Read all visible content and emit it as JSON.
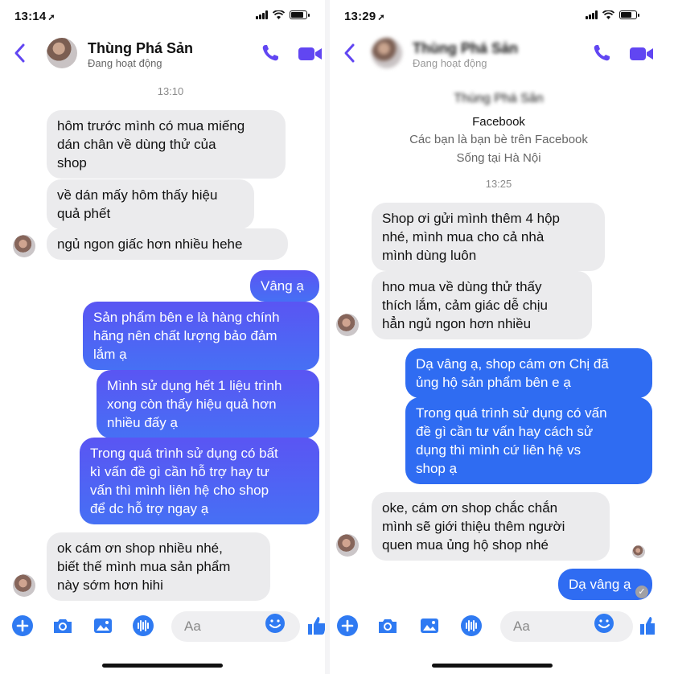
{
  "colors": {
    "accent": "#6146f2",
    "outgoing": "#4f63f4",
    "incoming": "#ebebed",
    "composer_blue": "#2f7af2"
  },
  "left": {
    "status_time": "13:14",
    "contact_name": "Thùng Phá Sản",
    "contact_status": "Đang hoạt động",
    "time_label": "13:10",
    "messages": [
      {
        "from": "them",
        "text": "hôm trước mình có mua miếng\ndán chân về dùng thử của\nshop"
      },
      {
        "from": "them",
        "text": "về dán mấy hôm thấy hiệu\nquả phết"
      },
      {
        "from": "them",
        "text": "ngủ ngon giấc hơn nhiều hehe"
      },
      {
        "from": "me",
        "text": "Vâng ạ"
      },
      {
        "from": "me",
        "text": "Sản phẩm bên e là hàng chính\nhãng nên chất lượng bảo đảm\nlắm ạ"
      },
      {
        "from": "me",
        "text": "Mình sử dụng hết 1 liệu trình\nxong còn thấy hiệu quả hơn\nnhiều đấy ạ"
      },
      {
        "from": "me",
        "text": "Trong quá trình sử dụng có bất\nkì vấn đề gì cần hỗ trợ hay tư\nvấn thì mình liên hệ cho shop\nđể dc hỗ trợ ngay ạ"
      },
      {
        "from": "them",
        "text": "ok cám ơn shop nhiều nhé,\nbiết thế mình mua sản phẩm\nnày sớm hơn hihi"
      }
    ],
    "composer_placeholder": "Aa"
  },
  "right": {
    "status_time": "13:29",
    "contact_name": "Thùng Phá Sản",
    "contact_status": "Đang hoạt động",
    "profile_name": "Thùng Phá Sản",
    "profile_source": "Facebook",
    "profile_friends": "Các bạn là bạn bè trên Facebook",
    "profile_location": "Sống tại Hà Nội",
    "time_label": "13:25",
    "messages": [
      {
        "from": "them",
        "text": "Shop ơi gửi mình thêm 4 hộp\nnhé, mình mua cho cả nhà\nmình dùng luôn"
      },
      {
        "from": "them",
        "text": "hno mua về dùng thử thấy\nthích lắm, cảm giác dễ chịu\nhẳn ngủ ngon hơn nhiều"
      },
      {
        "from": "me",
        "text": "Dạ vâng ạ, shop cám ơn Chị đã\nủng hộ sản phẩm bên e ạ"
      },
      {
        "from": "me",
        "text": "Trong quá trình sử dụng có vấn\nđề gì cần tư vấn hay cách sử\ndụng thì mình cứ liên hệ vs\nshop ạ"
      },
      {
        "from": "them",
        "text": "oke, cám ơn shop chắc chắn\nmình sẽ giới thiệu thêm người\nquen mua ủng hộ shop nhé"
      },
      {
        "from": "me",
        "text": "Dạ vâng ạ"
      }
    ],
    "composer_placeholder": "Aa"
  }
}
